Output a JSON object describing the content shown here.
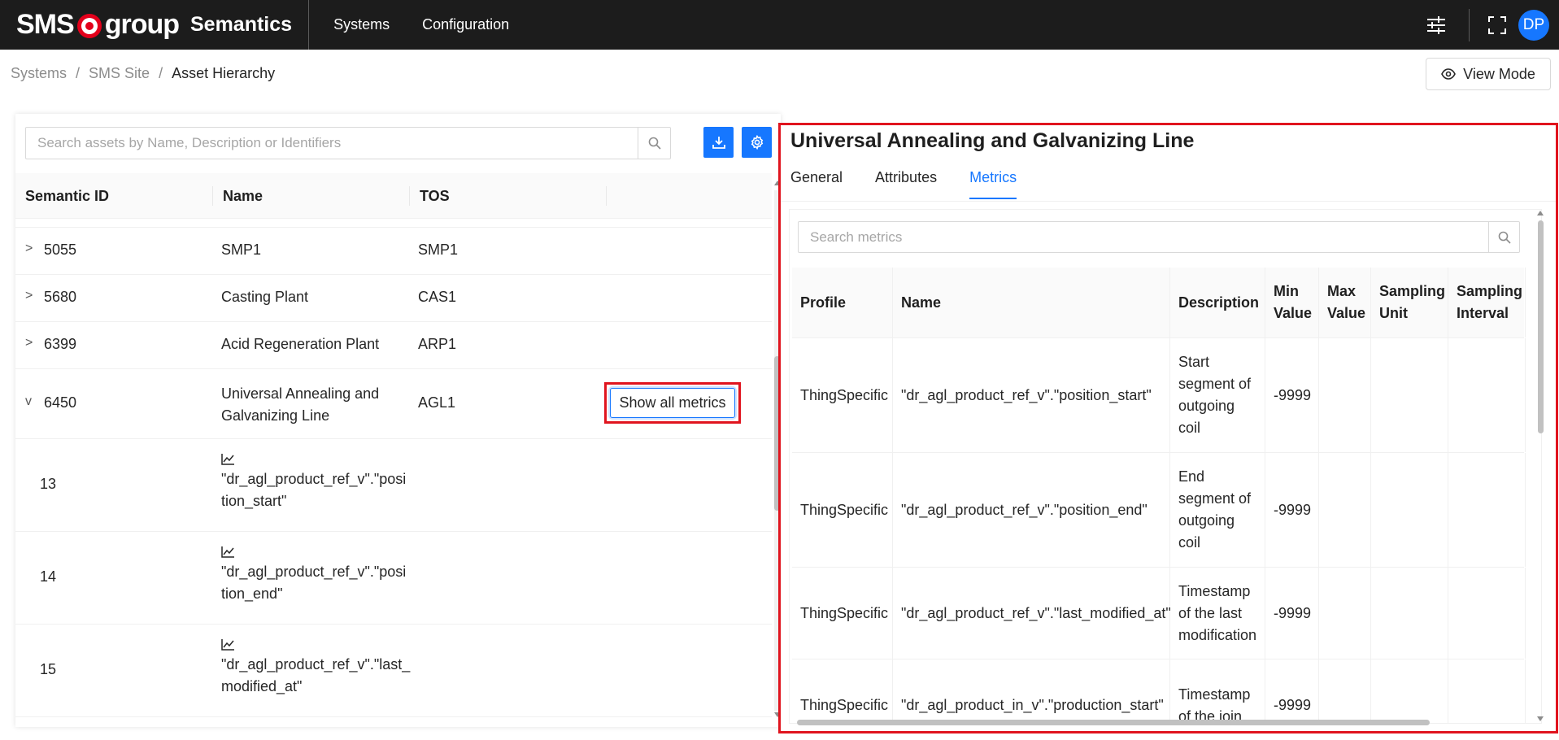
{
  "header": {
    "logo_sms": "SMS",
    "logo_group": "group",
    "product": "Semantics",
    "nav": [
      "Systems",
      "Configuration"
    ],
    "avatar": "DP"
  },
  "breadcrumb": {
    "items": [
      "Systems",
      "SMS Site"
    ],
    "current": "Asset Hierarchy",
    "separator": "/"
  },
  "view_mode_label": "View Mode",
  "left": {
    "search_placeholder": "Search assets by Name, Description or Identifiers",
    "columns": [
      "Semantic ID",
      "Name",
      "TOS"
    ],
    "rows": [
      {
        "id": "5055",
        "name": "SMP1",
        "tos": "SMP1",
        "chevron": ">"
      },
      {
        "id": "5680",
        "name": "Casting Plant",
        "tos": "CAS1",
        "chevron": ">"
      },
      {
        "id": "6399",
        "name": "Acid Regeneration Plant",
        "tos": "ARP1",
        "chevron": ">"
      },
      {
        "id": "6450",
        "name_line1": "Universal Annealing and",
        "name_line2": "Galvanizing Line",
        "tos": "AGL1",
        "chevron": "v"
      }
    ],
    "show_all_metrics": "Show all metrics",
    "children": [
      {
        "id": "13",
        "line1": "\"dr_agl_product_ref_v\".\"posi",
        "line2": "tion_start\""
      },
      {
        "id": "14",
        "line1": "\"dr_agl_product_ref_v\".\"posi",
        "line2": "tion_end\""
      },
      {
        "id": "15",
        "line1": "\"dr_agl_product_ref_v\".\"last_",
        "line2": "modified_at\""
      }
    ]
  },
  "right": {
    "title": "Universal Annealing and Galvanizing Line",
    "tabs": [
      "General",
      "Attributes",
      "Metrics"
    ],
    "active_tab": "Metrics",
    "search_placeholder": "Search metrics",
    "columns": {
      "profile": "Profile",
      "name": "Name",
      "description": "Description",
      "min_1": "Min",
      "min_2": "Value",
      "max_1": "Max",
      "max_2": "Value",
      "unit_1": "Sampling",
      "unit_2": "Unit",
      "interval_1": "Sampling",
      "interval_2": "Interval"
    },
    "rows": [
      {
        "profile": "ThingSpecific",
        "name": "\"dr_agl_product_ref_v\".\"position_start\"",
        "desc": [
          "Start",
          "segment of",
          "outgoing",
          "coil"
        ],
        "min": "-9999"
      },
      {
        "profile": "ThingSpecific",
        "name": "\"dr_agl_product_ref_v\".\"position_end\"",
        "desc": [
          "End",
          "segment of",
          "outgoing",
          "coil"
        ],
        "min": "-9999"
      },
      {
        "profile": "ThingSpecific",
        "name": "\"dr_agl_product_ref_v\".\"last_modified_at\"",
        "desc": [
          "Timestamp",
          "of the last",
          "modification"
        ],
        "min": "-9999"
      },
      {
        "profile": "ThingSpecific",
        "name": "\"dr_agl_product_in_v\".\"production_start\"",
        "desc": [
          "Timestamp",
          "of the join"
        ],
        "min": "-9999"
      }
    ]
  },
  "colors": {
    "accent": "#1677ff",
    "highlight": "#e0141e",
    "topbar": "#1c1c1c"
  }
}
